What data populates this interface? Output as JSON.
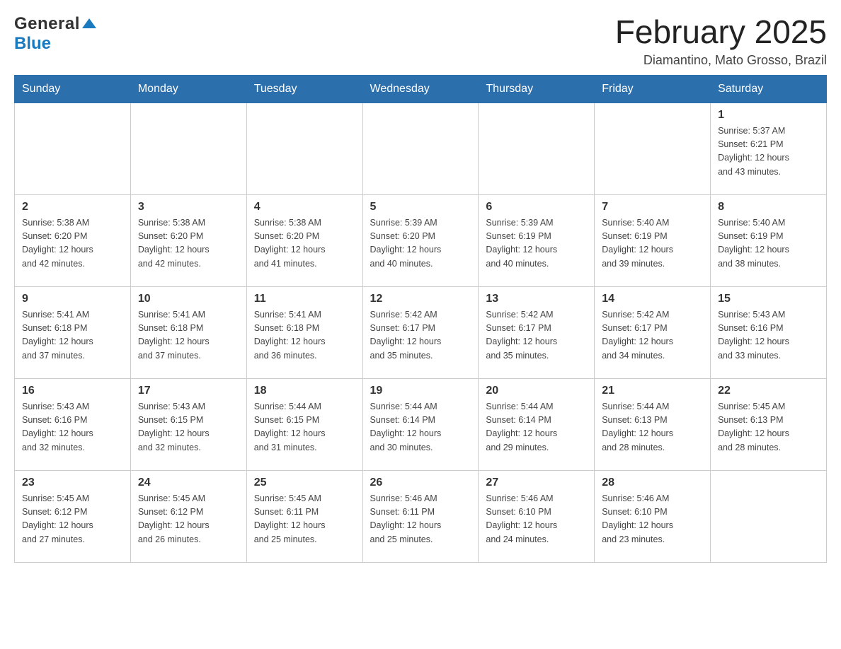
{
  "header": {
    "month_title": "February 2025",
    "location": "Diamantino, Mato Grosso, Brazil",
    "logo_general": "General",
    "logo_blue": "Blue"
  },
  "weekdays": [
    "Sunday",
    "Monday",
    "Tuesday",
    "Wednesday",
    "Thursday",
    "Friday",
    "Saturday"
  ],
  "weeks": [
    {
      "days": [
        {
          "number": "",
          "info": ""
        },
        {
          "number": "",
          "info": ""
        },
        {
          "number": "",
          "info": ""
        },
        {
          "number": "",
          "info": ""
        },
        {
          "number": "",
          "info": ""
        },
        {
          "number": "",
          "info": ""
        },
        {
          "number": "1",
          "info": "Sunrise: 5:37 AM\nSunset: 6:21 PM\nDaylight: 12 hours\nand 43 minutes."
        }
      ]
    },
    {
      "days": [
        {
          "number": "2",
          "info": "Sunrise: 5:38 AM\nSunset: 6:20 PM\nDaylight: 12 hours\nand 42 minutes."
        },
        {
          "number": "3",
          "info": "Sunrise: 5:38 AM\nSunset: 6:20 PM\nDaylight: 12 hours\nand 42 minutes."
        },
        {
          "number": "4",
          "info": "Sunrise: 5:38 AM\nSunset: 6:20 PM\nDaylight: 12 hours\nand 41 minutes."
        },
        {
          "number": "5",
          "info": "Sunrise: 5:39 AM\nSunset: 6:20 PM\nDaylight: 12 hours\nand 40 minutes."
        },
        {
          "number": "6",
          "info": "Sunrise: 5:39 AM\nSunset: 6:19 PM\nDaylight: 12 hours\nand 40 minutes."
        },
        {
          "number": "7",
          "info": "Sunrise: 5:40 AM\nSunset: 6:19 PM\nDaylight: 12 hours\nand 39 minutes."
        },
        {
          "number": "8",
          "info": "Sunrise: 5:40 AM\nSunset: 6:19 PM\nDaylight: 12 hours\nand 38 minutes."
        }
      ]
    },
    {
      "days": [
        {
          "number": "9",
          "info": "Sunrise: 5:41 AM\nSunset: 6:18 PM\nDaylight: 12 hours\nand 37 minutes."
        },
        {
          "number": "10",
          "info": "Sunrise: 5:41 AM\nSunset: 6:18 PM\nDaylight: 12 hours\nand 37 minutes."
        },
        {
          "number": "11",
          "info": "Sunrise: 5:41 AM\nSunset: 6:18 PM\nDaylight: 12 hours\nand 36 minutes."
        },
        {
          "number": "12",
          "info": "Sunrise: 5:42 AM\nSunset: 6:17 PM\nDaylight: 12 hours\nand 35 minutes."
        },
        {
          "number": "13",
          "info": "Sunrise: 5:42 AM\nSunset: 6:17 PM\nDaylight: 12 hours\nand 35 minutes."
        },
        {
          "number": "14",
          "info": "Sunrise: 5:42 AM\nSunset: 6:17 PM\nDaylight: 12 hours\nand 34 minutes."
        },
        {
          "number": "15",
          "info": "Sunrise: 5:43 AM\nSunset: 6:16 PM\nDaylight: 12 hours\nand 33 minutes."
        }
      ]
    },
    {
      "days": [
        {
          "number": "16",
          "info": "Sunrise: 5:43 AM\nSunset: 6:16 PM\nDaylight: 12 hours\nand 32 minutes."
        },
        {
          "number": "17",
          "info": "Sunrise: 5:43 AM\nSunset: 6:15 PM\nDaylight: 12 hours\nand 32 minutes."
        },
        {
          "number": "18",
          "info": "Sunrise: 5:44 AM\nSunset: 6:15 PM\nDaylight: 12 hours\nand 31 minutes."
        },
        {
          "number": "19",
          "info": "Sunrise: 5:44 AM\nSunset: 6:14 PM\nDaylight: 12 hours\nand 30 minutes."
        },
        {
          "number": "20",
          "info": "Sunrise: 5:44 AM\nSunset: 6:14 PM\nDaylight: 12 hours\nand 29 minutes."
        },
        {
          "number": "21",
          "info": "Sunrise: 5:44 AM\nSunset: 6:13 PM\nDaylight: 12 hours\nand 28 minutes."
        },
        {
          "number": "22",
          "info": "Sunrise: 5:45 AM\nSunset: 6:13 PM\nDaylight: 12 hours\nand 28 minutes."
        }
      ]
    },
    {
      "days": [
        {
          "number": "23",
          "info": "Sunrise: 5:45 AM\nSunset: 6:12 PM\nDaylight: 12 hours\nand 27 minutes."
        },
        {
          "number": "24",
          "info": "Sunrise: 5:45 AM\nSunset: 6:12 PM\nDaylight: 12 hours\nand 26 minutes."
        },
        {
          "number": "25",
          "info": "Sunrise: 5:45 AM\nSunset: 6:11 PM\nDaylight: 12 hours\nand 25 minutes."
        },
        {
          "number": "26",
          "info": "Sunrise: 5:46 AM\nSunset: 6:11 PM\nDaylight: 12 hours\nand 25 minutes."
        },
        {
          "number": "27",
          "info": "Sunrise: 5:46 AM\nSunset: 6:10 PM\nDaylight: 12 hours\nand 24 minutes."
        },
        {
          "number": "28",
          "info": "Sunrise: 5:46 AM\nSunset: 6:10 PM\nDaylight: 12 hours\nand 23 minutes."
        },
        {
          "number": "",
          "info": ""
        }
      ]
    }
  ]
}
